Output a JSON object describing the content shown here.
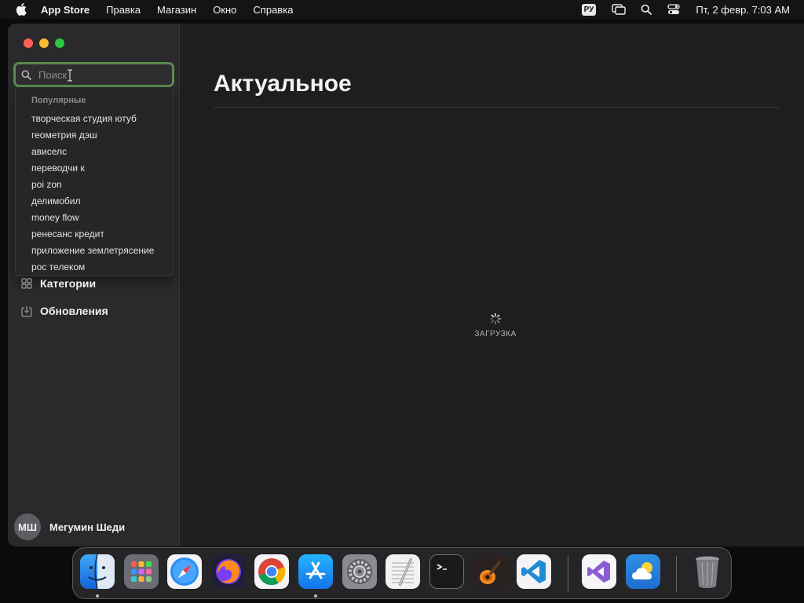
{
  "menubar": {
    "app_name": "App Store",
    "items": [
      "Правка",
      "Магазин",
      "Окно",
      "Справка"
    ],
    "input_source": "РУ",
    "clock": "Пт, 2 февр.  7:03 AM"
  },
  "sidebar": {
    "search": {
      "placeholder": "Поиск",
      "value": ""
    },
    "suggestions": {
      "header": "Популярные",
      "items": [
        "творческая студия ютуб",
        "геометрия дэш",
        "ависелс",
        "переводчи к",
        "poi zon",
        "делимобил",
        "money flow",
        "ренесанс кредит",
        "приложение землетрясение",
        "рос телеком"
      ]
    },
    "nav": [
      {
        "label": "Категории",
        "icon": "categories-icon"
      },
      {
        "label": "Обновления",
        "icon": "updates-icon"
      }
    ],
    "user": {
      "initials": "МШ",
      "name": "Мегумин Шеди"
    }
  },
  "main": {
    "title": "Актуальное",
    "loading_text": "ЗАГРУЗКА"
  },
  "dock": {
    "apps": [
      "finder-icon",
      "launchpad-icon",
      "safari-icon",
      "firefox-icon",
      "chrome-icon",
      "app-store-icon",
      "system-settings-icon",
      "textedit-icon",
      "terminal-icon",
      "garageband-icon",
      "vscode-icon",
      "visual-studio-icon",
      "weather-icon",
      "trash-icon"
    ]
  },
  "colors": {
    "search_focus_ring": "#5a8a4f",
    "close": "#fe5f57",
    "minimize": "#febc2e",
    "maximize": "#28c840"
  }
}
